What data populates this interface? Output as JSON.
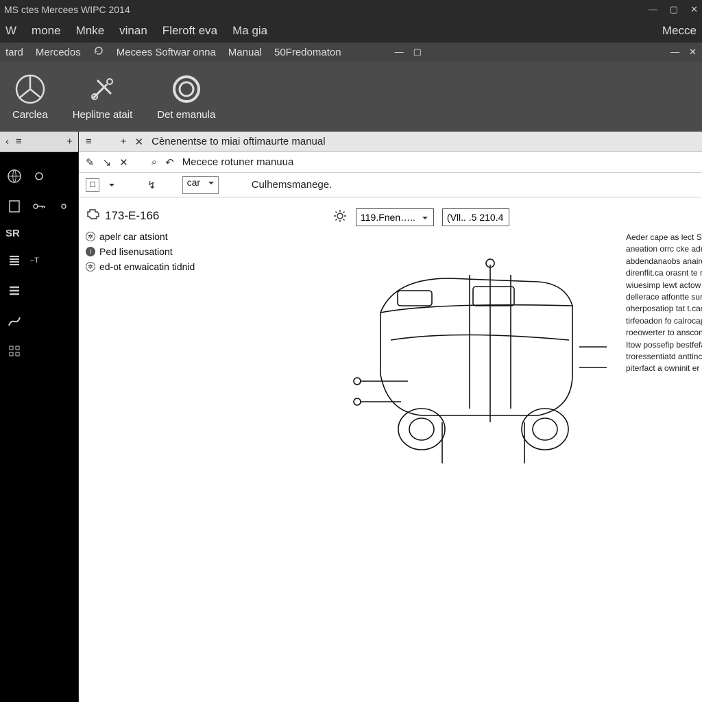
{
  "window": {
    "title": "MS ctes Mercees WIPC 2014",
    "controls": {
      "min": "—",
      "max": "▢",
      "close": "✕"
    }
  },
  "menu": {
    "items": [
      "W",
      "mone",
      "Mnke",
      "vinan",
      "Fleroft eva",
      "Ma gia"
    ],
    "right": "Mecce"
  },
  "ribbonTabs": {
    "items": [
      "tard",
      "Mercedos",
      "Mecees Softwar onna",
      "Manual",
      "50Fredomaton"
    ],
    "icon_after_mercedos": "refresh-icon"
  },
  "ribbon": {
    "items": [
      {
        "label": "Carclea",
        "icon": "mercedes-star-icon"
      },
      {
        "label": "Heplitne atait",
        "icon": "tools-icon"
      },
      {
        "label": "Det emanula",
        "icon": "circle-icon"
      }
    ]
  },
  "sidebar": {
    "top": {
      "a": "‹",
      "b": "≡",
      "c": "+"
    },
    "label_sr": "SR"
  },
  "tabbar": {
    "hamburger": "≡",
    "plus": "+",
    "close": "✕",
    "title": "Cènenentse to miai oftimaurte manual"
  },
  "toolbar": {
    "pencil": "✎",
    "arrow": "↘",
    "close": "✕",
    "search": "⌕",
    "undo": "↶",
    "title": "Mecece rotuner manuua"
  },
  "filter": {
    "checkbox": "☐",
    "chev": "▾",
    "wand": "↯",
    "drop_label": "car",
    "right_label": "Culhemsmanege.",
    "far_right_icon": "⧉"
  },
  "tree": {
    "title_code": "173-E-166",
    "items": [
      "apelr car atsiont",
      "Ped lisenusationt",
      "ed-ot enwaicatin tidnid"
    ]
  },
  "figheader": {
    "select1": "119.Fnen…..",
    "select2": "(Vll.. .5 210.4"
  },
  "description": "Aeder cape as lect SIF desransninces aneation orrc cke adr queder pad art abdendanaobs anaird k/ VUEs abr/I direnflit.ca orasnt te rorssvara daec wiuesimp lewt actow . The oupmex of dellerace atfontte sur/oevins at s oherposatiop tat t.cao a cata ades orfel dia tirfeoadon fo calrocapoctres ouf wall roeowerter to ansconnehanwyg antssant Itow possefip bestfefareworrt we troressentiatd anttincenefesfincurcule ante piterfact a owninit er pe onenterfesl"
}
